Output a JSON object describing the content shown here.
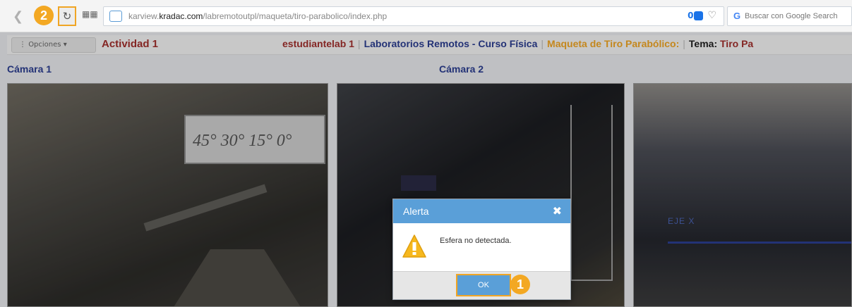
{
  "browser": {
    "url_prefix": "karview.",
    "url_domain": "kradac.com",
    "url_path": "/labremotoutpl/maqueta/tiro-parabolico/index.php",
    "blocked_count": "0",
    "search_placeholder": "Buscar con Google Search",
    "search_logo": "G"
  },
  "callouts": {
    "reload": "2",
    "ok": "1"
  },
  "header": {
    "opciones_label": "Opciones",
    "actividad": "Actividad 1",
    "user": "estudiantelab 1",
    "lab": "Laboratorios Remotos - Curso Física",
    "maqueta": "Maqueta de Tiro Parabólico:",
    "tema_label": "Tema:",
    "tema_value": "Tiro Pa"
  },
  "cameras": {
    "cam1_title": "Cámara 1",
    "cam2_title": "Cámara 2"
  },
  "camera_overlay": {
    "angles": "45° 30° 15° 0°",
    "eje_label": "EJE X"
  },
  "modal": {
    "title": "Alerta",
    "message": "Esfera no detectada.",
    "ok_label": "OK"
  },
  "colors": {
    "accent": "#f0a524",
    "modal_header": "#5a9fd8",
    "title_blue": "#2b3d91",
    "title_red": "#a12f2c"
  },
  "icons": {
    "back": "chevron-left-icon",
    "reload": "reload-icon",
    "apps": "apps-grid-icon",
    "site": "site-cloud-icon",
    "shield": "shield-icon",
    "heart": "heart-icon",
    "close": "close-icon",
    "warning": "warning-icon"
  }
}
